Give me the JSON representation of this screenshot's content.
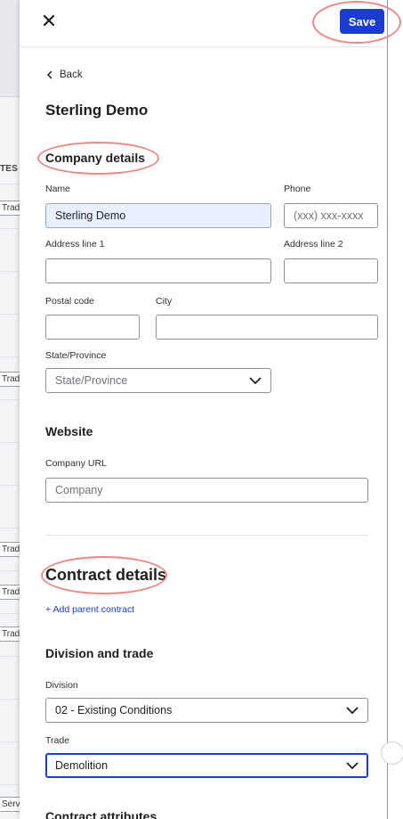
{
  "background": {
    "column_header": "TES",
    "chips": [
      "Trade",
      "Trade",
      "Trade",
      "Trade",
      "Trade",
      "Servi"
    ]
  },
  "drawer": {
    "save_label": "Save",
    "back_label": "Back",
    "title": "Sterling Demo",
    "company_details": {
      "heading": "Company details",
      "name_label": "Name",
      "name_value": "Sterling Demo",
      "phone_label": "Phone",
      "phone_placeholder": "(xxx) xxx-xxxx",
      "address1_label": "Address line 1",
      "address2_label": "Address line 2",
      "postal_label": "Postal code",
      "city_label": "City",
      "state_label": "State/Province",
      "state_placeholder": "State/Province"
    },
    "website": {
      "heading": "Website",
      "url_label": "Company URL",
      "url_placeholder": "Company"
    },
    "contract_details": {
      "heading": "Contract details",
      "add_parent_label": "+ Add parent contract"
    },
    "division_trade": {
      "heading": "Division and trade",
      "division_label": "Division",
      "division_value": "02 - Existing Conditions",
      "trade_label": "Trade",
      "trade_value": "Demolition"
    },
    "contract_attributes": {
      "heading": "Contract attributes"
    }
  },
  "colors": {
    "primary": "#1a3ccf",
    "annotation": "#e98a8a",
    "filled_input": "#e8efff"
  },
  "icons": [
    "close-icon",
    "chevron-left-icon",
    "chevron-down-icon"
  ]
}
